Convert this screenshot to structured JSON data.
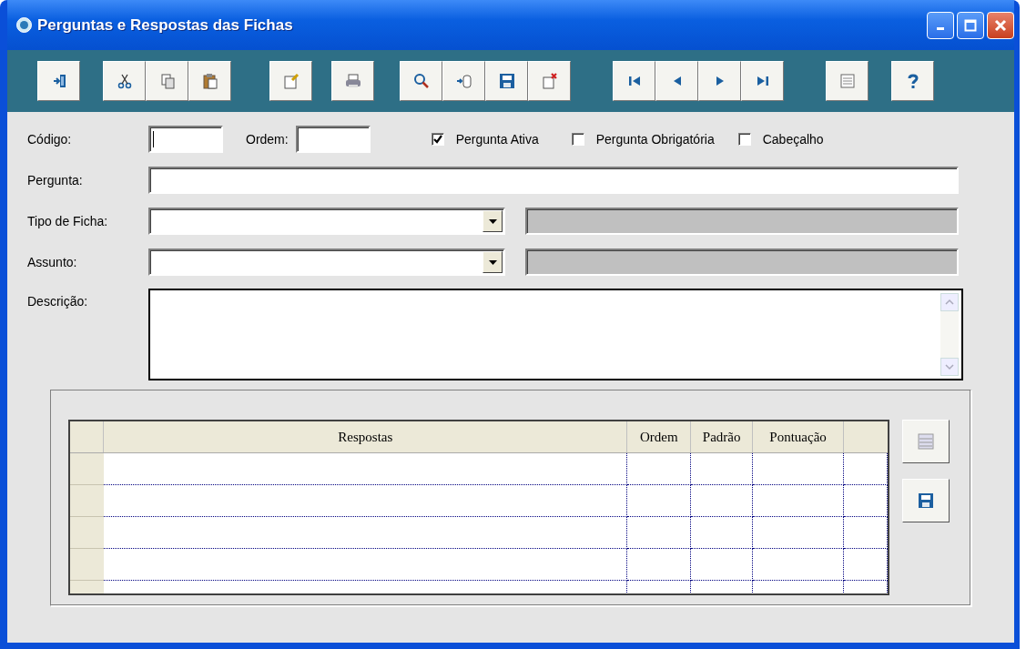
{
  "window": {
    "title": "Perguntas e Respostas das Fichas"
  },
  "form": {
    "codigo": {
      "label": "Código:"
    },
    "ordem": {
      "label": "Ordem:"
    },
    "checkboxes": [
      {
        "label": "Pergunta Ativa",
        "checked": true
      },
      {
        "label": "Pergunta Obrigatória",
        "checked": false
      },
      {
        "label": "Cabeçalho",
        "checked": false
      }
    ],
    "pergunta": {
      "label": "Pergunta:"
    },
    "tipo_de_ficha": {
      "label": "Tipo de Ficha:"
    },
    "assunto": {
      "label": "Assunto:"
    },
    "descricao": {
      "label": "Descrição:"
    }
  },
  "table": {
    "columns": [
      "Respostas",
      "Ordem",
      "Padrão",
      "Pontuação"
    ]
  }
}
